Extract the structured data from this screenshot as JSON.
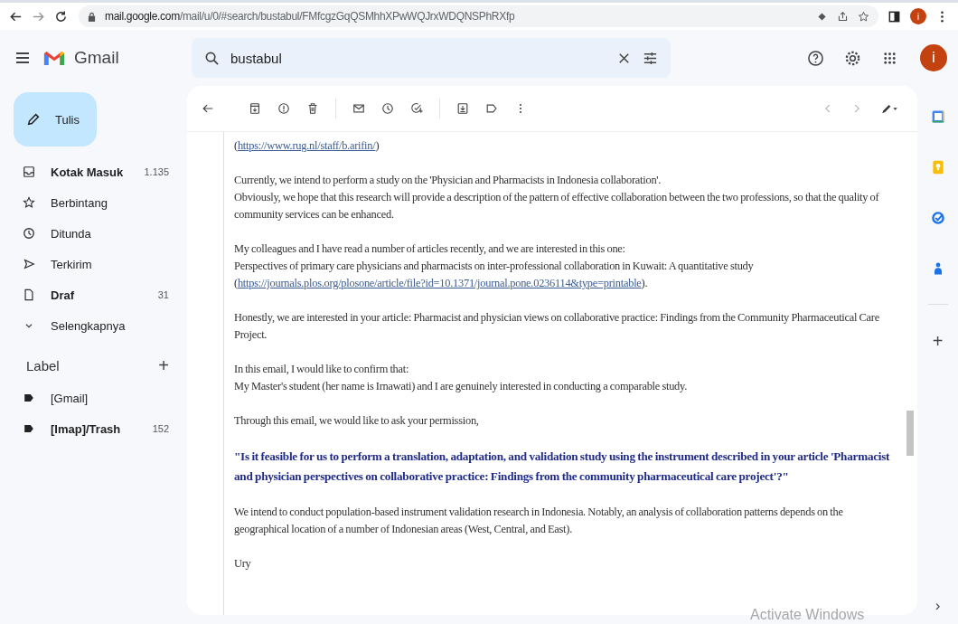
{
  "browser": {
    "url_host": "mail.google.com",
    "url_path": "/mail/u/0/#search/bustabul/FMfcgzGqQSMhhXPwWQJrxWDQNSPhRXfp",
    "profile_letter": "i"
  },
  "header": {
    "app_name": "Gmail",
    "search_value": "bustabul",
    "avatar_letter": "i"
  },
  "compose": {
    "label": "Tulis"
  },
  "nav": [
    {
      "kind": "inbox",
      "label": "Kotak Masuk",
      "count": "1.135",
      "unread": true
    },
    {
      "kind": "starred",
      "label": "Berbintang",
      "unread": false
    },
    {
      "kind": "snoozed",
      "label": "Ditunda",
      "unread": false
    },
    {
      "kind": "sent",
      "label": "Terkirim",
      "unread": false
    },
    {
      "kind": "drafts",
      "label": "Draf",
      "count": "31",
      "unread": true
    },
    {
      "kind": "more",
      "label": "Selengkapnya",
      "unread": false
    }
  ],
  "labels": {
    "title": "Label",
    "add": "+",
    "items": [
      {
        "label": "[Gmail]",
        "unread": false
      },
      {
        "label": "[Imap]/Trash",
        "count": "152",
        "unread": true
      }
    ]
  },
  "message": {
    "paragraphs": [
      {
        "kind": "text",
        "lines": [
          [
            {
              "text": "("
            },
            {
              "text": "https://www.rug.nl/staff/b.arifin/",
              "link": true
            },
            {
              "text": ")"
            }
          ]
        ]
      },
      {
        "kind": "text",
        "lines": [
          [
            {
              "text": "Currently, we intend to perform a study on the 'Physician and Pharmacists in Indonesia collaboration'."
            }
          ],
          [
            {
              "text": "Obviously, we hope that this research will provide a description of the pattern of effective collaboration between the two professions, so that the quality of community services can be enhanced."
            }
          ]
        ]
      },
      {
        "kind": "text",
        "lines": [
          [
            {
              "text": "My colleagues and I have read a number of articles recently, and we are interested in this one:"
            }
          ],
          [
            {
              "text": "Perspectives of primary care physicians and pharmacists on inter-professional collaboration in Kuwait: A quantitative study ("
            },
            {
              "text": "https://journals.plos.org/",
              "link": true
            },
            {
              "text": "plosone/article/file?id=10.1371/journal.pone.0236114&type=printable",
              "link": true
            },
            {
              "text": ")."
            }
          ]
        ]
      },
      {
        "kind": "text",
        "lines": [
          [
            {
              "text": "Honestly, we are interested in your article: Pharmacist and physician views on collaborative practice: Findings from the Community Pharmaceutical Care Project."
            }
          ]
        ]
      },
      {
        "kind": "text",
        "lines": [
          [
            {
              "text": "In this email, I would like to confirm that:"
            }
          ],
          [
            {
              "text": "My Master's student (her name is Irnawati) and I are genuinely interested in conducting a comparable study."
            }
          ]
        ]
      },
      {
        "kind": "text",
        "lines": [
          [
            {
              "text": "Through this email, we would like to ask your permission,"
            }
          ]
        ]
      },
      {
        "kind": "quote",
        "lines": [
          [
            {
              "text": "\"Is it feasible for us to perform a translation, adaptation, and validation study using the instrument described in your article 'Pharmacist and physician perspectives on collaborative practice: Findings from the community pharmaceutical care project'?\""
            }
          ]
        ]
      },
      {
        "kind": "text",
        "lines": [
          [
            {
              "text": "We intend to conduct population-based instrument validation research in Indonesia. Notably, an analysis of collaboration patterns depends on the geographical location of a number of Indonesian areas (West, Central, and East)."
            }
          ]
        ]
      },
      {
        "kind": "text",
        "lines": [
          [
            {
              "text": "Ury"
            }
          ]
        ]
      }
    ]
  },
  "rail": {
    "add": "+",
    "expand": "›"
  },
  "os_notice": "Activate Windows"
}
